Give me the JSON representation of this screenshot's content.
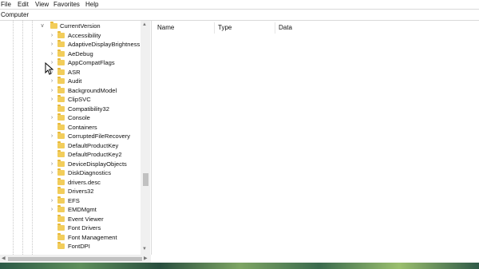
{
  "menu": [
    "File",
    "Edit",
    "View",
    "Favorites",
    "Help"
  ],
  "address": "Computer",
  "tree": {
    "parent": "CurrentVersion",
    "items": [
      {
        "label": "Accessibility",
        "expandable": true
      },
      {
        "label": "AdaptiveDisplayBrightness",
        "expandable": true
      },
      {
        "label": "AeDebug",
        "expandable": true
      },
      {
        "label": "AppCompatFlags",
        "expandable": true
      },
      {
        "label": "ASR",
        "expandable": true
      },
      {
        "label": "Audit",
        "expandable": true
      },
      {
        "label": "BackgroundModel",
        "expandable": true
      },
      {
        "label": "ClipSVC",
        "expandable": true
      },
      {
        "label": "Compatibility32",
        "expandable": false
      },
      {
        "label": "Console",
        "expandable": true
      },
      {
        "label": "Containers",
        "expandable": false
      },
      {
        "label": "CorruptedFileRecovery",
        "expandable": true
      },
      {
        "label": "DefaultProductKey",
        "expandable": false
      },
      {
        "label": "DefaultProductKey2",
        "expandable": false
      },
      {
        "label": "DeviceDisplayObjects",
        "expandable": true
      },
      {
        "label": "DiskDiagnostics",
        "expandable": true
      },
      {
        "label": "drivers.desc",
        "expandable": false
      },
      {
        "label": "Drivers32",
        "expandable": false
      },
      {
        "label": "EFS",
        "expandable": true
      },
      {
        "label": "EMDMgmt",
        "expandable": true
      },
      {
        "label": "Event Viewer",
        "expandable": false
      },
      {
        "label": "Font Drivers",
        "expandable": false
      },
      {
        "label": "Font Management",
        "expandable": false
      },
      {
        "label": "FontDPI",
        "expandable": false
      }
    ]
  },
  "columns": {
    "name": "Name",
    "type": "Type",
    "data": "Data"
  },
  "colors": {
    "folder": "#f2cd5b",
    "border": "#d9d9d9",
    "scroll": "#f0f0f0",
    "thumb": "#c1c1c1"
  }
}
